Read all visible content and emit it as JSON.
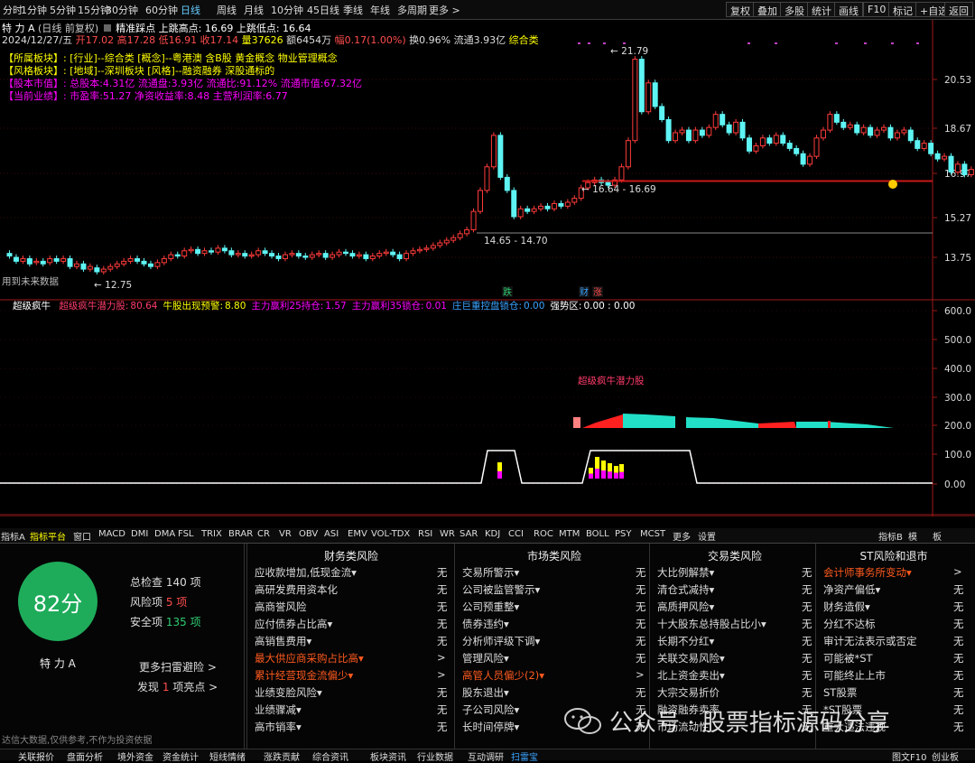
{
  "toolbar": {
    "periods": [
      "分时",
      "1分钟",
      "5分钟",
      "15分钟",
      "30分钟",
      "60分钟",
      "日线",
      "周线",
      "月线",
      "10分钟",
      "45日线",
      "季线",
      "年线",
      "多周期",
      "更多 >"
    ],
    "active": "日线",
    "right": [
      "复权",
      "叠加",
      "多股",
      "统计",
      "画线",
      "F10",
      "标记",
      "+自选",
      "返回"
    ]
  },
  "header": {
    "line1_name": "特 力 A",
    "line1_mode": "(日线 前复权)",
    "line1_title": "精准踩点",
    "line1_high": "上跳高点: 16.69",
    "line1_low": "上跳低点: 16.64",
    "line2": {
      "date": "2024/12/27/五",
      "open": "开17.02",
      "high": "高17.28",
      "low": "低16.91",
      "close": "收17.14",
      "vol": "量37626",
      "amount": "额6454万",
      "pct": "幅0.17(1.00%)",
      "turnover": "换0.96%",
      "float": "流通3.93亿",
      "cat": "综合类"
    },
    "info": [
      {
        "k": "【所属板块】:",
        "v": "[行业]--综合类 [概念]--粤港澳 含B股 黄金概念 物业管理概念"
      },
      {
        "k": "【风格板块】:",
        "v": "[地域]--深圳板块 [风格]--融资融券 深股通标的"
      },
      {
        "k": "【股本市值】:",
        "v": "总股本:4.31亿 流通盘:3.93亿 流通比:91.12% 流通市值:67.32亿"
      },
      {
        "k": "【当前业绩】:",
        "v": "市盈率:51.27 净资收益率:8.48 主营利润率:6.77"
      }
    ]
  },
  "price_axis": [
    "20.53",
    "18.67",
    "16.97",
    "15.27",
    "13.75"
  ],
  "annotations": {
    "peak": "21.79",
    "support": "16.64 - 16.69",
    "support2": "14.65 - 14.70",
    "low": "12.75",
    "future": "用到未来数据",
    "marks": [
      "跌",
      "财",
      "涨"
    ]
  },
  "indicator": {
    "name": "超级疯牛",
    "items": [
      {
        "k": "超级疯牛潜力股:",
        "v": "80.64",
        "color": "#ff3b6b"
      },
      {
        "k": "牛股出现预警:",
        "v": "8.80",
        "color": "#ffff00"
      },
      {
        "k": "主力赢利25持仓:",
        "v": "1.57",
        "color": "#ff00ff"
      },
      {
        "k": "主力赢利35锁仓:",
        "v": "0.01",
        "color": "#ff00ff"
      },
      {
        "k": "庄巨重控盘锁仓:",
        "v": "0.00",
        "color": "#3aa3ff"
      },
      {
        "k": "强势区:",
        "v": "0.00 : 0.00",
        "color": "#ffffff"
      }
    ],
    "label": "超级疯牛潜力股",
    "axis": [
      "600.0",
      "500.0",
      "400.0",
      "300.0",
      "200.0",
      "100.0",
      "0.00"
    ]
  },
  "xaxis": {
    "year": "2024年",
    "months": [
      "7",
      "8",
      "9",
      "10",
      "11",
      "12"
    ],
    "right": "日线"
  },
  "tabs": [
    "指标A",
    "指标平台",
    "窗口",
    "MACD",
    "DMI",
    "DMA",
    "FSL",
    "TRIX",
    "BRAR",
    "CR",
    "VR",
    "OBV",
    "ASI",
    "EMV",
    "VOL-TDX",
    "RSI",
    "WR",
    "SAR",
    "KDJ",
    "CCI",
    "ROC",
    "MTM",
    "BOLL",
    "PSY",
    "MCST",
    "更多",
    "设置"
  ],
  "tabs_active": "指标平台",
  "tabs_right": [
    "指标B",
    "模",
    "板"
  ],
  "risk": {
    "score": "82分",
    "stock": "特 力 A",
    "summary": [
      {
        "k": "总检查",
        "v": "140 项",
        "c": "#ddd"
      },
      {
        "k": "风险项",
        "v": "5 项",
        "c": "#ff4d4d"
      },
      {
        "k": "安全项",
        "v": "135 项",
        "c": "#2ecc71"
      }
    ],
    "more": "更多扫雷避险 >",
    "found_pre": "发现",
    "found_num": "1",
    "found_post": "项亮点 >",
    "columns": [
      {
        "title": "财务类风险",
        "items": [
          [
            "应收款增加,低现金流▾",
            "无",
            0
          ],
          [
            "高研发费用资本化",
            "无",
            0
          ],
          [
            "高商誉风险",
            "无",
            0
          ],
          [
            "应付债券占比高▾",
            "无",
            0
          ],
          [
            "高销售费用▾",
            "无",
            0
          ],
          [
            "最大供应商采购占比高▾",
            ">",
            1
          ],
          [
            "累计经营现金流偏少▾",
            ">",
            1
          ],
          [
            "业绩变脸风险▾",
            "无",
            0
          ],
          [
            "业绩骤减▾",
            "无",
            0
          ],
          [
            "高市销率▾",
            "无",
            0
          ]
        ]
      },
      {
        "title": "市场类风险",
        "items": [
          [
            "交易所警示▾",
            "无",
            0
          ],
          [
            "公司被监管警示▾",
            "无",
            0
          ],
          [
            "公司预重整▾",
            "无",
            0
          ],
          [
            "债券违约▾",
            "无",
            0
          ],
          [
            "分析师评级下调▾",
            "无",
            0
          ],
          [
            "管理风险▾",
            "无",
            0
          ],
          [
            "高管人员偏少(2)▾",
            ">",
            1
          ],
          [
            "股东退出▾",
            "无",
            0
          ],
          [
            "子公司风险▾",
            "无",
            0
          ],
          [
            "长时间停牌▾",
            "无",
            0
          ]
        ]
      },
      {
        "title": "交易类风险",
        "items": [
          [
            "大比例解禁▾",
            "无",
            0
          ],
          [
            "清仓式减持▾",
            "无",
            0
          ],
          [
            "高质押风险▾",
            "无",
            0
          ],
          [
            "十大股东总持股占比小▾",
            "无",
            0
          ],
          [
            "长期不分红▾",
            "无",
            0
          ],
          [
            "关联交易风险▾",
            "无",
            0
          ],
          [
            "北上资金卖出▾",
            "无",
            0
          ],
          [
            "大宗交易折价",
            "无",
            0
          ],
          [
            "融资融券卖率",
            "无",
            0
          ],
          [
            "市场流动性",
            "无",
            0
          ]
        ]
      },
      {
        "title": "ST风险和退市",
        "items": [
          [
            "会计师事务所变动▾",
            ">",
            1
          ],
          [
            "净资产偏低▾",
            "无",
            0
          ],
          [
            "财务造假▾",
            "无",
            0
          ],
          [
            "分红不达标",
            "无",
            0
          ],
          [
            "审计无法表示或否定",
            "无",
            0
          ],
          [
            "可能被*ST",
            "无",
            0
          ],
          [
            "可能终止上市",
            "无",
            0
          ],
          [
            "ST股票",
            "无",
            0
          ],
          [
            "*ST股票",
            "无",
            0
          ],
          [
            "重大违法违规",
            "无",
            0
          ]
        ]
      }
    ],
    "disclaimer": "达信大数据,仅供参考,不作为投资依据"
  },
  "watermark": "公众号 · 股票指标源码分享",
  "footer": {
    "left": [
      "关联报价",
      "盘面分析",
      "境外资金",
      "资金统计",
      "短线情绪",
      "涨跌贡献",
      "综合资讯",
      "板块资讯",
      "行业数据",
      "互动调研",
      "扫雷宝"
    ],
    "active": "扫雷宝",
    "right": [
      "图文F10",
      "创业板"
    ]
  },
  "chart_data": [
    {
      "type": "candlestick",
      "title": "",
      "price_axis": [
        20.53,
        18.67,
        16.97,
        15.27,
        13.75
      ],
      "annotated_levels": {
        "peak": 21.79,
        "support_band": [
          16.64,
          16.69
        ],
        "lower_band": [
          14.65,
          14.7
        ],
        "low": 12.75
      },
      "last_bar": {
        "open": 17.02,
        "high": 17.28,
        "low": 16.91,
        "close": 17.14
      }
    },
    {
      "type": "bar",
      "title": "超级疯牛",
      "ylim": [
        0,
        600
      ],
      "yticks": [
        0,
        100,
        200,
        300,
        400,
        500,
        600
      ],
      "series": [
        {
          "name": "超级疯牛潜力股",
          "last": 80.64
        },
        {
          "name": "牛股出现预警",
          "last": 8.8
        },
        {
          "name": "主力赢利25持仓",
          "last": 1.57
        },
        {
          "name": "主力赢利35锁仓",
          "last": 0.01
        },
        {
          "name": "庄巨重控盘锁仓",
          "last": 0.0
        }
      ]
    }
  ]
}
